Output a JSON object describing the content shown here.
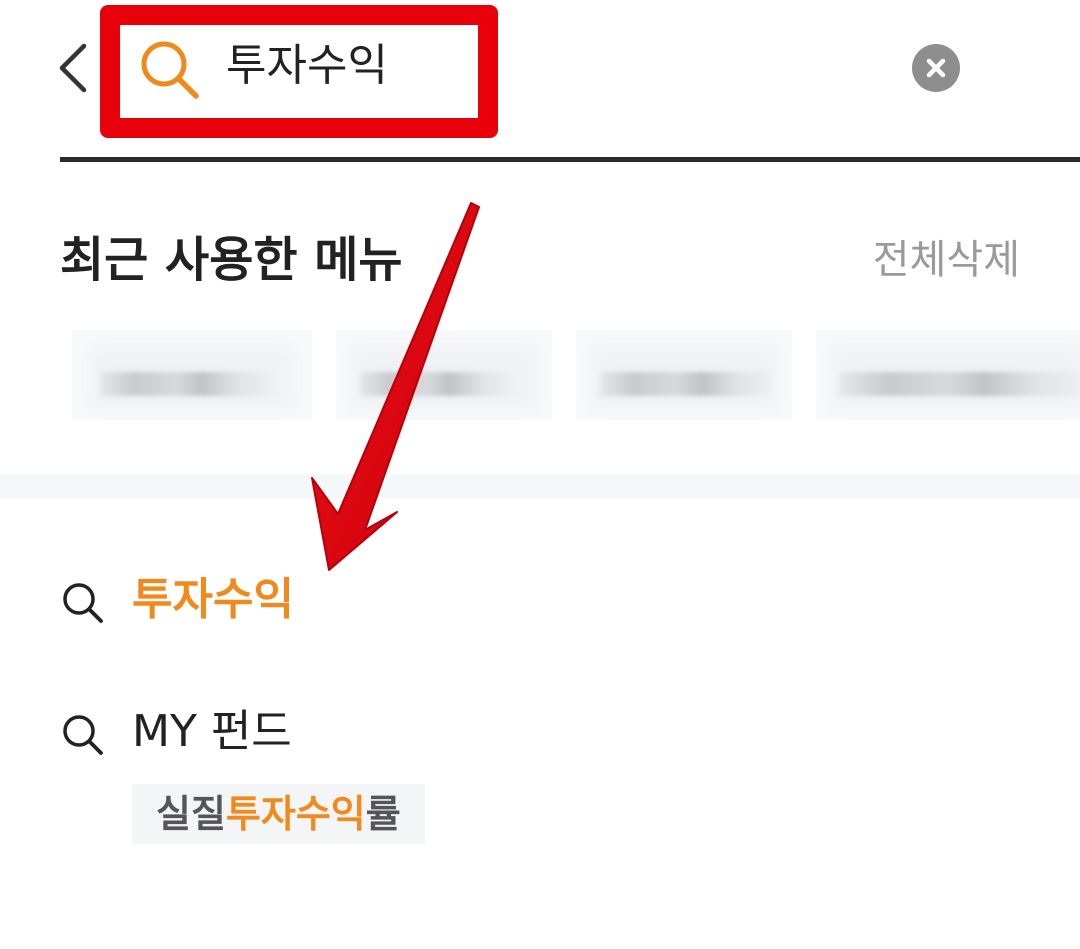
{
  "search": {
    "query": "투자수익",
    "clear_icon": "close-circle-icon",
    "search_icon": "search-icon",
    "back_icon": "chevron-left-icon"
  },
  "recent": {
    "title": "최근 사용한 메뉴",
    "delete_all_label": "전체삭제",
    "chips_obscured": true
  },
  "results": [
    {
      "label": "투자수익",
      "highlight": true
    },
    {
      "label": "MY 펀드",
      "highlight": false
    }
  ],
  "sub_result": {
    "prefix": "실질",
    "highlight": "투자수익",
    "suffix": "률"
  },
  "annotations": {
    "highlight_box_color": "#e8000b",
    "arrow_color": "#e8000b"
  },
  "colors": {
    "accent_orange": "#f08a1c",
    "text_dark": "#222222",
    "text_muted": "#9a9a9a"
  }
}
